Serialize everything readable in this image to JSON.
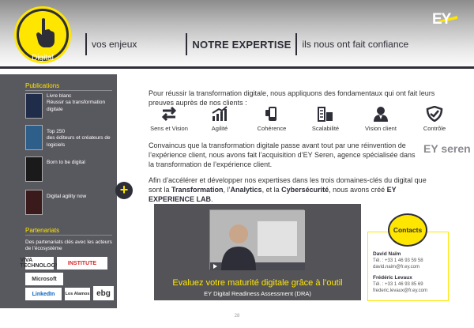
{
  "header": {
    "digital_label": "Digital",
    "brand": "EY",
    "nav": [
      "vos enjeux",
      "NOTRE EXPERTISE",
      "ils nous ont fait confiance"
    ],
    "colors": {
      "accent": "#ffe600",
      "dark": "#2e2e38"
    }
  },
  "sidebar": {
    "publications_title": "Publications",
    "publications": [
      {
        "label": "Livre blanc\nRéussir sa transformation digitale",
        "thumb_color": "#1f2d4a"
      },
      {
        "label": "Top 250\ndes éditeurs et créateurs de logiciels",
        "thumb_color": "#2d5f8a"
      },
      {
        "label": "Born to be digital",
        "thumb_color": "#1a1a1a"
      },
      {
        "label": "Digital agility now",
        "thumb_color": "#3a1a1a"
      }
    ],
    "plus_label": "+",
    "partners_title": "Partenariats",
    "partners_text": "Des partenariats clés avec les acteurs de l’écosystème",
    "partners": [
      "VIVA TECHNOLOGY",
      "INSTITUTE",
      "Microsoft",
      "LinkedIn",
      "Los Alamos",
      "ebg"
    ]
  },
  "main": {
    "intro": "Pour réussir la transformation digitale, nous appliquons des fondamentaux qui ont fait leurs preuves auprès de nos clients :",
    "icons": [
      {
        "label": "Sens et Vision",
        "icon": "arrows-icon"
      },
      {
        "label": "Agilité",
        "icon": "chart-up-icon"
      },
      {
        "label": "Cohérence",
        "icon": "phone-icon"
      },
      {
        "label": "Scalabilité",
        "icon": "building-icon"
      },
      {
        "label": "Vision client",
        "icon": "user-icon"
      },
      {
        "label": "Contrôle",
        "icon": "shield-icon"
      }
    ],
    "para1": "Convaincus que la transformation digitale passe avant tout par une réinvention de l’expérience client, nous avons fait l’acquisition d’EY Seren, agence spécialisée dans la transformation de l’expérience client.",
    "eyseren": "EY seren",
    "para2_start": "Afin d’accélérer et développer nos expertises dans les trois domaines-clés du digital que sont la ",
    "para2_b1": "Transformation",
    "para2_m1": ", l’",
    "para2_b2": "Analytics",
    "para2_m2": ", et la ",
    "para2_b3": "Cybersécurité",
    "para2_m3": ", nous avons créé ",
    "para2_b4": "EY EXPERIENCE LAB",
    "para2_end": "."
  },
  "video": {
    "title": "Evaluez votre maturité digitale grâce à l’outil",
    "subtitle": "EY Digital Readiness Assessment (DRA)"
  },
  "contacts": {
    "title": "Contacts",
    "people": [
      {
        "name": "David Naïm",
        "tel": "Tél. : +33 1 46 93 59 58",
        "email": "david.naim@fr.ey.com"
      },
      {
        "name": "Frédéric Levaux",
        "tel": "Tél. : +33 1 46 93 85 69",
        "email": "frederic.levaux@fr.ey.com"
      }
    ]
  },
  "page_number": "28"
}
